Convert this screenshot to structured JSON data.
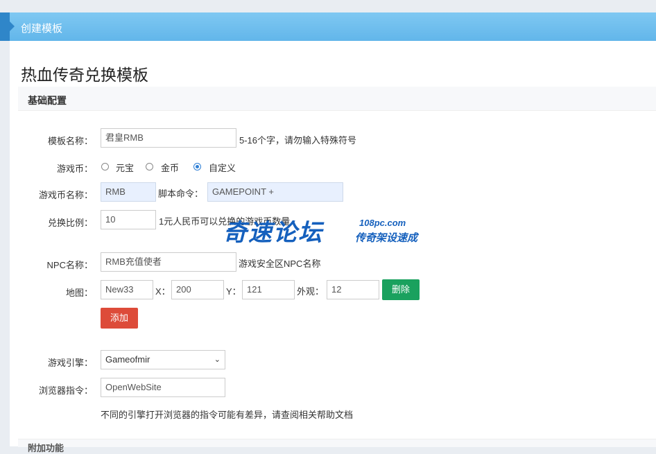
{
  "header": {
    "title": "创建模板"
  },
  "page": {
    "title": "热血传奇兑换模板"
  },
  "section": {
    "title": "基础配置",
    "next_title": "附加功能"
  },
  "form": {
    "template_name": {
      "label": "模板名称：",
      "value": "君皇RMB",
      "hint": "5-16个字，请勿输入特殊符号"
    },
    "currency": {
      "label": "游戏币：",
      "options": [
        "元宝",
        "金币",
        "自定义"
      ],
      "selected": "自定义"
    },
    "currency_name": {
      "label": "游戏币名称：",
      "value": "RMB",
      "script_label": "脚本命令：",
      "script_value": "GAMEPOINT +"
    },
    "ratio": {
      "label": "兑换比例：",
      "value": "10",
      "hint": "1元人民币可以兑换的游戏币数量"
    },
    "npc": {
      "label": "NPC名称：",
      "value": "RMB充值使者",
      "hint": "游戏安全区NPC名称"
    },
    "map": {
      "label": "地图：",
      "map_value": "New33",
      "x_label": "X：",
      "x_value": "200",
      "y_label": "Y：",
      "y_value": "121",
      "look_label": "外观：",
      "look_value": "12",
      "delete_label": "删除",
      "add_label": "添加"
    },
    "engine": {
      "label": "游戏引擎：",
      "value": "Gameofmir"
    },
    "browser": {
      "label": "浏览器指令：",
      "value": "OpenWebSite",
      "hint": "不同的引擎打开浏览器的指令可能有差异，请查阅相关帮助文档"
    }
  },
  "watermark": {
    "main": "奇速论坛",
    "url": "108pc.com",
    "sub": "传奇架设速成"
  },
  "colors": {
    "header": "#62b6ea",
    "delete_btn": "#1aa15e",
    "add_btn": "#dd4b39",
    "radio_on": "#2f7fd5"
  }
}
